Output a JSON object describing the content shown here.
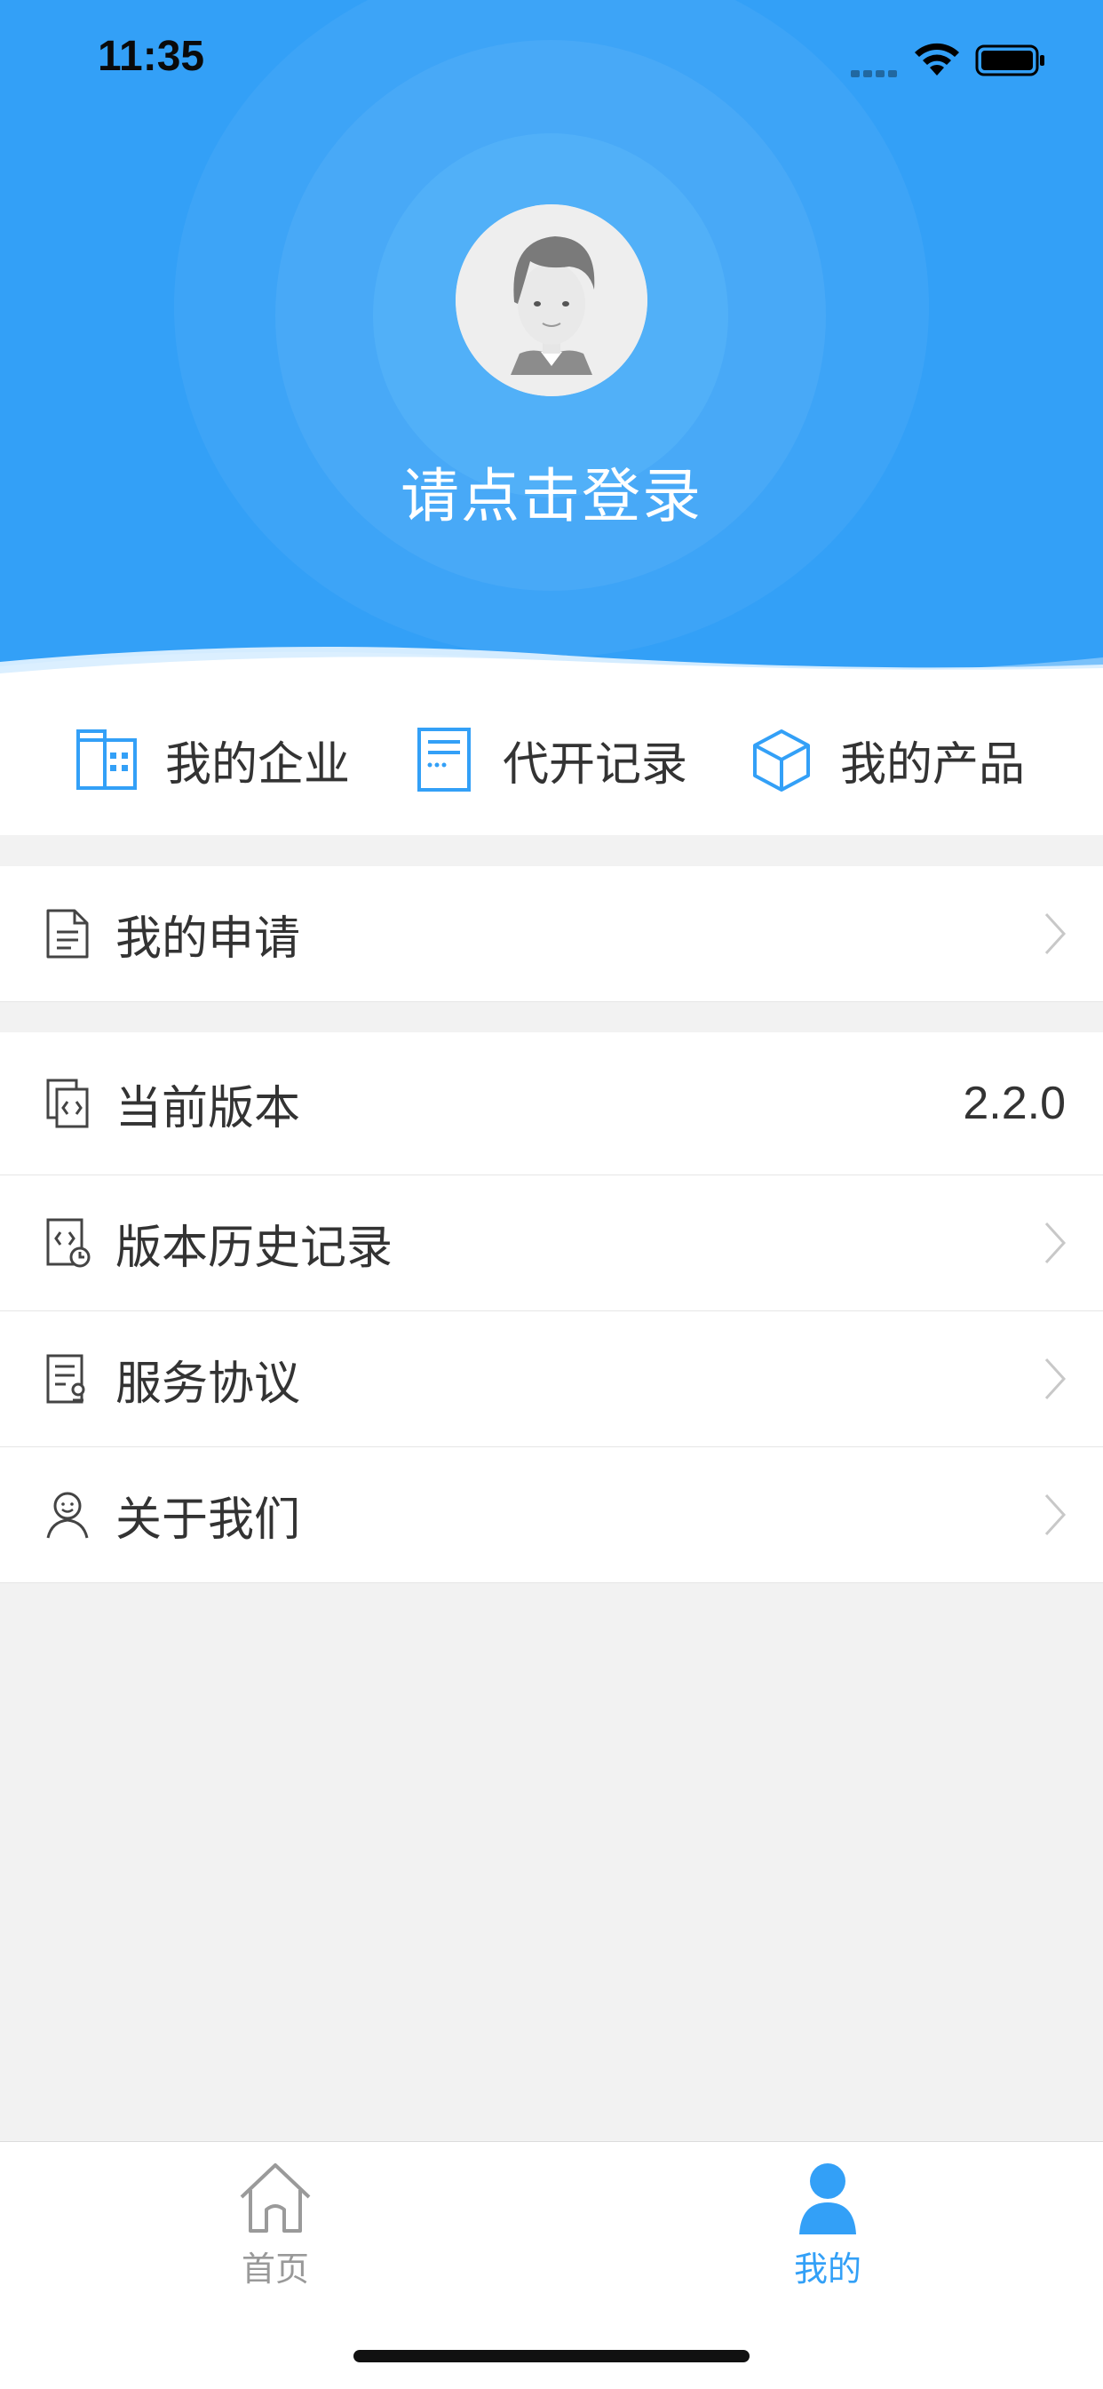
{
  "status_bar": {
    "time": "11:35"
  },
  "header": {
    "login_prompt": "请点击登录"
  },
  "quick_actions": [
    {
      "label": "我的企业",
      "icon": "building-icon"
    },
    {
      "label": "代开记录",
      "icon": "invoice-record-icon"
    },
    {
      "label": "我的产品",
      "icon": "cube-icon"
    }
  ],
  "menu": {
    "applications": {
      "label": "我的申请",
      "icon": "document-icon"
    },
    "version": {
      "label": "当前版本",
      "value": "2.2.0",
      "icon": "code-file-icon"
    },
    "version_history": {
      "label": "版本历史记录",
      "icon": "history-file-icon"
    },
    "service_agreement": {
      "label": "服务协议",
      "icon": "agreement-icon"
    },
    "about_us": {
      "label": "关于我们",
      "icon": "smile-person-icon"
    }
  },
  "tab_bar": {
    "home": {
      "label": "首页",
      "icon": "home-icon"
    },
    "mine": {
      "label": "我的",
      "icon": "person-icon"
    }
  },
  "colors": {
    "primary": "#33a0f7",
    "text": "#333333",
    "muted": "#999999",
    "background": "#f2f2f2"
  }
}
